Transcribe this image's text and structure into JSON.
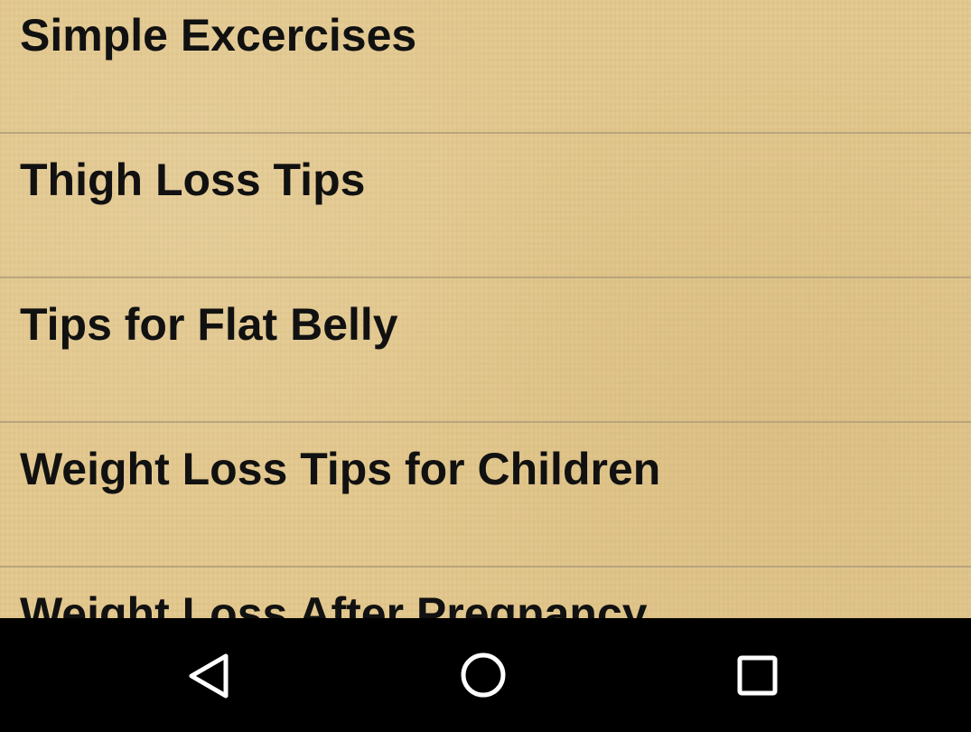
{
  "list": {
    "items": [
      {
        "label": "Simple Excercises"
      },
      {
        "label": "Thigh Loss Tips"
      },
      {
        "label": "Tips for Flat Belly"
      },
      {
        "label": "Weight Loss Tips for Children"
      },
      {
        "label": "Weight Loss After Pregnancy"
      }
    ]
  },
  "navbar": {
    "buttons": [
      {
        "icon": "back-icon"
      },
      {
        "icon": "home-icon"
      },
      {
        "icon": "recents-icon"
      }
    ],
    "icon_color": "#ffffff"
  },
  "colors": {
    "background": "#e3c78c",
    "divider": "#b9a57c",
    "text": "#111111",
    "navbar": "#000000"
  }
}
